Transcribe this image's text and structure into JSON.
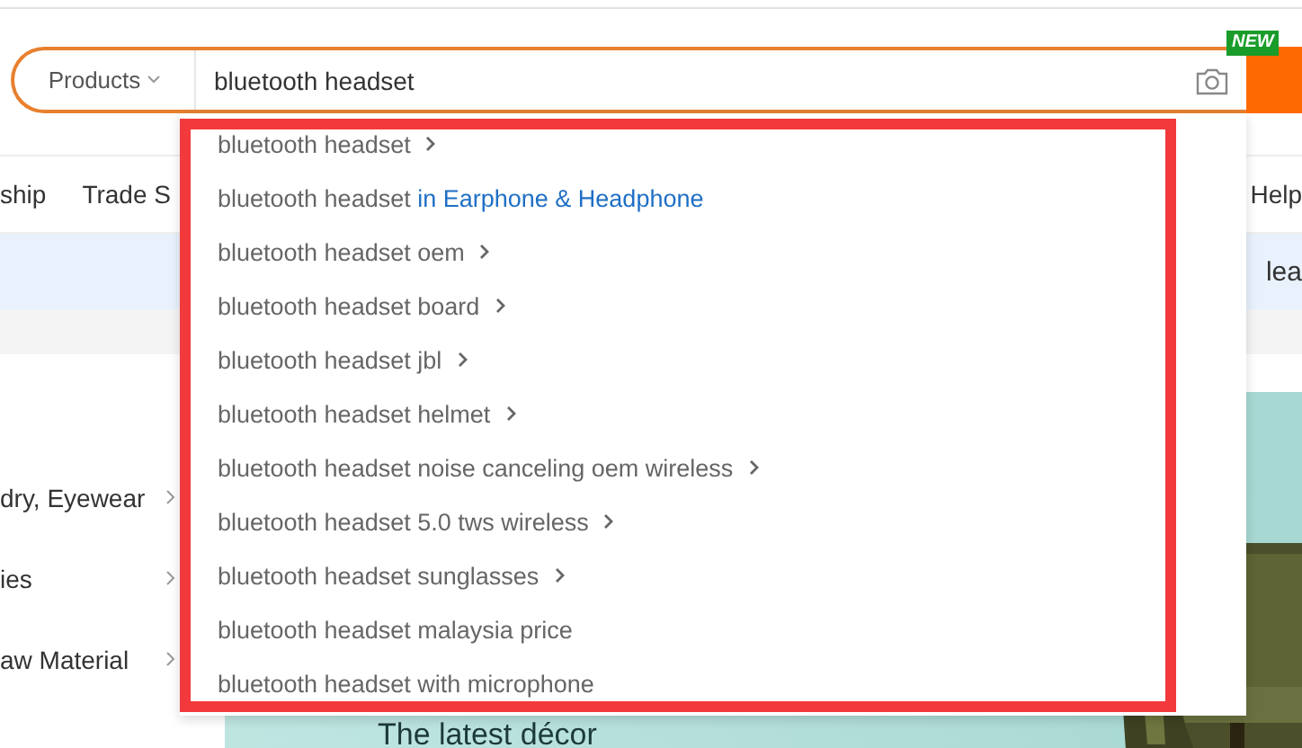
{
  "search": {
    "scope": "Products",
    "value": "bluetooth headset",
    "badge": "NEW"
  },
  "nav": [
    {
      "label": "ship"
    },
    {
      "label": "Trade S"
    },
    {
      "label": "Help"
    }
  ],
  "notice": {
    "text": "lea"
  },
  "categories": [
    {
      "label": "dry, Eyewear"
    },
    {
      "label": "ies"
    },
    {
      "label": "aw Material"
    }
  ],
  "banner": {
    "heading": "The latest décor"
  },
  "suggestions": [
    {
      "kind": "more",
      "text": "bluetooth headset"
    },
    {
      "kind": "category",
      "text": "bluetooth headset",
      "category": "in Earphone & Headphone"
    },
    {
      "kind": "more",
      "text": "bluetooth headset oem"
    },
    {
      "kind": "more",
      "text": "bluetooth headset board"
    },
    {
      "kind": "more",
      "text": "bluetooth headset jbl"
    },
    {
      "kind": "more",
      "text": "bluetooth headset helmet"
    },
    {
      "kind": "more",
      "text": "bluetooth headset noise canceling oem wireless"
    },
    {
      "kind": "more",
      "text": "bluetooth headset 5.0 tws wireless"
    },
    {
      "kind": "more",
      "text": "bluetooth headset sunglasses"
    },
    {
      "kind": "plain",
      "text": "bluetooth headset malaysia price"
    },
    {
      "kind": "plain",
      "text": "bluetooth headset with microphone"
    }
  ]
}
